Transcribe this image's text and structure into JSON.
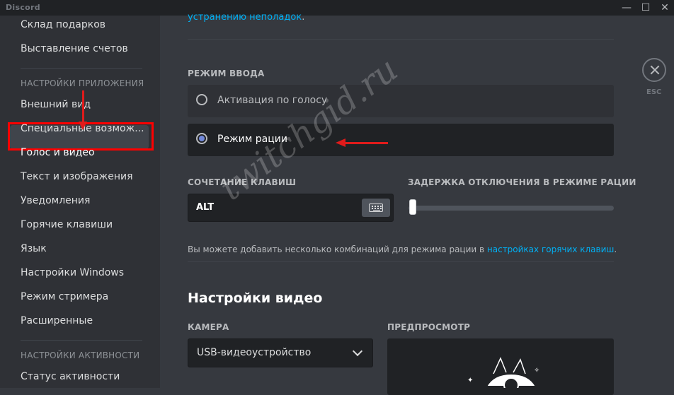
{
  "window": {
    "title": "Discord",
    "controls": {
      "minimize": "—",
      "maximize": "☐",
      "close": "✕"
    }
  },
  "sidebar": {
    "items_top": [
      "Склад подарков",
      "Выставление счетов"
    ],
    "app_settings_header": "НАСТРОЙКИ ПРИЛОЖЕНИЯ",
    "app_items": [
      "Внешний вид",
      "Специальные возмож...",
      "Голос и видео",
      "Текст и изображения",
      "Уведомления",
      "Горячие клавиши",
      "Язык",
      "Настройки Windows",
      "Режим стримера",
      "Расширенные"
    ],
    "selected": "Голос и видео",
    "activity_header": "НАСТРОЙКИ АКТИВНОСТИ",
    "activity_items": [
      "Статус активности"
    ]
  },
  "main": {
    "troubleshoot_link": "устранению неполадок",
    "troubleshoot_suffix": ".",
    "input_mode_label": "РЕЖИМ ВВОДА",
    "input_modes": [
      {
        "label": "Активация по голосу",
        "selected": false
      },
      {
        "label": "Режим рации",
        "selected": true
      }
    ],
    "keybind_label": "СОЧЕТАНИЕ КЛАВИШ",
    "keybind_value": "ALT",
    "release_delay_label": "ЗАДЕРЖКА ОТКЛЮЧЕНИЯ В РЕЖИМЕ РАЦИИ",
    "release_delay_level": 0,
    "help_text": "Вы можете добавить несколько комбинаций для режима рации в ",
    "help_link": "настройках горячих клавиш",
    "help_suffix": ".",
    "video_title": "Настройки видео",
    "camera_label": "КАМЕРА",
    "camera_value": "USB-видеоустройство",
    "preview_label": "ПРЕДПРОСМОТР"
  },
  "close": {
    "label": "ESC",
    "icon": "close-icon"
  },
  "watermark": "twitchgid.ru",
  "colors": {
    "background": "#36393f",
    "sidebar": "#2f3136",
    "accent": "#7289da",
    "link": "#00b0f4",
    "annotation": "#e01b1b"
  }
}
